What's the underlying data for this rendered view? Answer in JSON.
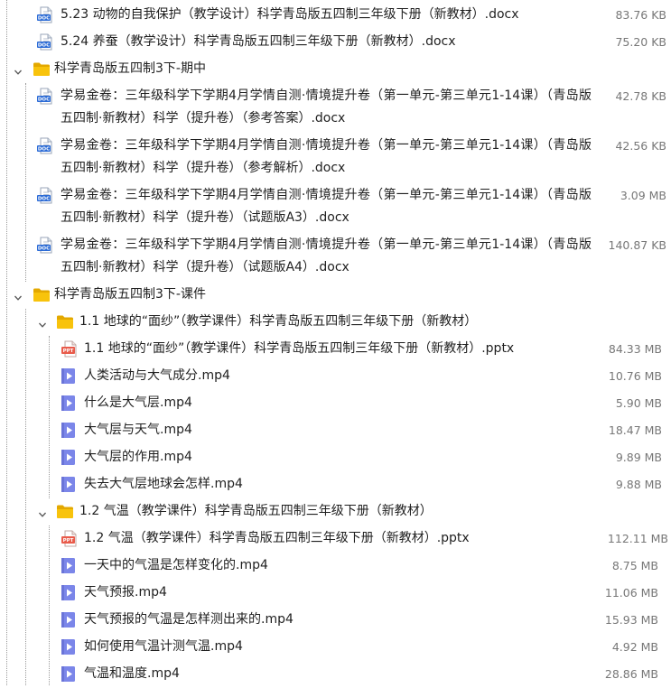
{
  "colors": {
    "folder": "#f8c30c",
    "folder_dark": "#e3a800",
    "doc_blue": "#2b6bd6",
    "video_blue": "#7b86e9",
    "ppt_red": "#e95b4b",
    "size_text": "#777777",
    "tree_line": "#9a9a9a"
  },
  "rows": [
    {
      "kind": "file",
      "icon": "word-doc-icon",
      "depth": 1,
      "name": "5.23 动物的自我保护（教学设计）科学青岛版五四制三年级下册（新教材）.docx",
      "size": "83.76 KB"
    },
    {
      "kind": "file",
      "icon": "word-doc-icon",
      "depth": 1,
      "name": "5.24 养蚕（教学设计）科学青岛版五四制三年级下册（新教材）.docx",
      "size": "75.20 KB"
    },
    {
      "kind": "folder",
      "icon": "folder-icon",
      "depth": 0,
      "name": "科学青岛版五四制3下-期中",
      "size": ""
    },
    {
      "kind": "file",
      "icon": "word-doc-icon",
      "depth": 1,
      "name": "学易金卷：三年级科学下学期4月学情自测·情境提升卷（第一单元-第三单元1-14课）（青岛版五四制·新教材）科学（提升卷）（参考答案）.docx",
      "size": "42.78 KB"
    },
    {
      "kind": "file",
      "icon": "word-doc-icon",
      "depth": 1,
      "name": "学易金卷：三年级科学下学期4月学情自测·情境提升卷（第一单元-第三单元1-14课）（青岛版五四制·新教材）科学（提升卷）（参考解析）.docx",
      "size": "42.56 KB"
    },
    {
      "kind": "file",
      "icon": "word-doc-icon",
      "depth": 1,
      "name": "学易金卷：三年级科学下学期4月学情自测·情境提升卷（第一单元-第三单元1-14课）（青岛版五四制·新教材）科学（提升卷）（试题版A3）.docx",
      "size": "3.09 MB"
    },
    {
      "kind": "file",
      "icon": "word-doc-icon",
      "depth": 1,
      "name": "学易金卷：三年级科学下学期4月学情自测·情境提升卷（第一单元-第三单元1-14课）（青岛版五四制·新教材）科学（提升卷）（试题版A4）.docx",
      "size": "140.87 KB"
    },
    {
      "kind": "folder",
      "icon": "folder-icon",
      "depth": 0,
      "name": "科学青岛版五四制3下-课件",
      "size": ""
    },
    {
      "kind": "folder",
      "icon": "folder-icon",
      "depth": 1,
      "name": "1.1 地球的“面纱”（教学课件）科学青岛版五四制三年级下册（新教材）",
      "size": ""
    },
    {
      "kind": "file",
      "icon": "ppt-icon",
      "depth": 2,
      "name": "1.1 地球的“面纱”（教学课件）科学青岛版五四制三年级下册（新教材）.pptx",
      "size": "84.33 MB"
    },
    {
      "kind": "file",
      "icon": "video-icon",
      "depth": 2,
      "name": "人类活动与大气成分.mp4",
      "size": "10.76 MB"
    },
    {
      "kind": "file",
      "icon": "video-icon",
      "depth": 2,
      "name": "什么是大气层.mp4",
      "size": "5.90 MB"
    },
    {
      "kind": "file",
      "icon": "video-icon",
      "depth": 2,
      "name": "大气层与天气.mp4",
      "size": "18.47 MB"
    },
    {
      "kind": "file",
      "icon": "video-icon",
      "depth": 2,
      "name": "大气层的作用.mp4",
      "size": "9.89 MB"
    },
    {
      "kind": "file",
      "icon": "video-icon",
      "depth": 2,
      "name": "失去大气层地球会怎样.mp4",
      "size": "9.88 MB"
    },
    {
      "kind": "folder",
      "icon": "folder-icon",
      "depth": 1,
      "name": "1.2 气温（教学课件）科学青岛版五四制三年级下册（新教材）",
      "size": ""
    },
    {
      "kind": "file",
      "icon": "ppt-icon",
      "depth": 2,
      "name": "1.2 气温（教学课件）科学青岛版五四制三年级下册（新教材）.pptx",
      "size": "112.11 MB"
    },
    {
      "kind": "file",
      "icon": "video-icon",
      "depth": 2,
      "name": "一天中的气温是怎样变化的.mp4",
      "size": "8.75 MB"
    },
    {
      "kind": "file",
      "icon": "video-icon",
      "depth": 2,
      "name": "天气预报.mp4",
      "size": "11.06 MB"
    },
    {
      "kind": "file",
      "icon": "video-icon",
      "depth": 2,
      "name": "天气预报的气温是怎样测出来的.mp4",
      "size": "15.93 MB"
    },
    {
      "kind": "file",
      "icon": "video-icon",
      "depth": 2,
      "name": "如何使用气温计测气温.mp4",
      "size": "4.92 MB"
    },
    {
      "kind": "file",
      "icon": "video-icon",
      "depth": 2,
      "name": "气温和温度.mp4",
      "size": "28.86 MB"
    }
  ]
}
